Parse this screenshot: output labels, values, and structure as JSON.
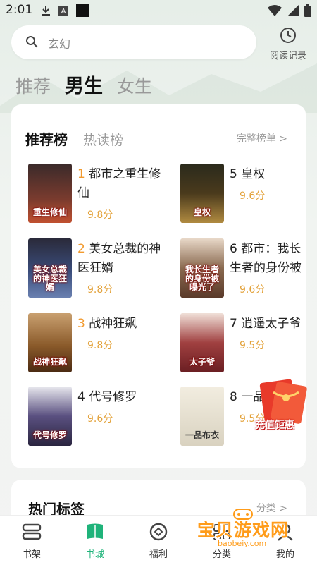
{
  "status_bar": {
    "time": "2:01"
  },
  "search": {
    "placeholder": "玄幻"
  },
  "history": {
    "label": "阅读记录"
  },
  "channel_tabs": [
    "推荐",
    "男生",
    "女生"
  ],
  "ranking": {
    "tabs": [
      "推荐榜",
      "热读榜"
    ],
    "full_link": "完整榜单 >",
    "books": [
      {
        "rank": "1",
        "title": "都市之重生修仙",
        "score": "9.8分",
        "cover_text": "重生修仙",
        "cover_color": "#7a3b2e"
      },
      {
        "rank": "2",
        "title": "美女总裁的神医狂婿",
        "score": "9.8分",
        "cover_text": "美女总裁的神医狂婿",
        "cover_color": "#3a4c7a"
      },
      {
        "rank": "3",
        "title": "战神狂飙",
        "score": "9.8分",
        "cover_text": "战神狂飙",
        "cover_color": "#8a5a2a"
      },
      {
        "rank": "4",
        "title": "代号修罗",
        "score": "9.6分",
        "cover_text": "代号修罗",
        "cover_color": "#2a2540"
      },
      {
        "rank": "5",
        "title": "皇权",
        "score": "9.6分",
        "cover_text": "皇权",
        "cover_color": "#4a3a1c"
      },
      {
        "rank": "6",
        "title": "都市：我长生者的身份被",
        "score": "9.6分",
        "cover_text": "我长生者的身份被曝光了",
        "cover_color": "#5a3a2a"
      },
      {
        "rank": "7",
        "title": "逍遥太子爷",
        "score": "9.5分",
        "cover_text": "太子爷",
        "cover_color": "#6a1e22"
      },
      {
        "rank": "8",
        "title": "一品布衣",
        "score": "9.5分",
        "cover_text": "一品布衣",
        "cover_color": "#d9d2c0"
      }
    ]
  },
  "hot_tags": {
    "title": "热门标签",
    "link": "分类 >"
  },
  "promo": {
    "label": "充值钜惠"
  },
  "watermark": {
    "text": "宝贝游戏网",
    "url": "baobeiy.com"
  },
  "nav": [
    {
      "label": "书架",
      "icon": "bookshelf-icon"
    },
    {
      "label": "书城",
      "icon": "book-icon"
    },
    {
      "label": "福利",
      "icon": "gift-icon"
    },
    {
      "label": "分类",
      "icon": "category-icon"
    },
    {
      "label": "我的",
      "icon": "profile-icon"
    }
  ],
  "colors": {
    "accent": "#1fb37a",
    "rank_hot": "#f29a2e",
    "score": "#e3a23a"
  }
}
